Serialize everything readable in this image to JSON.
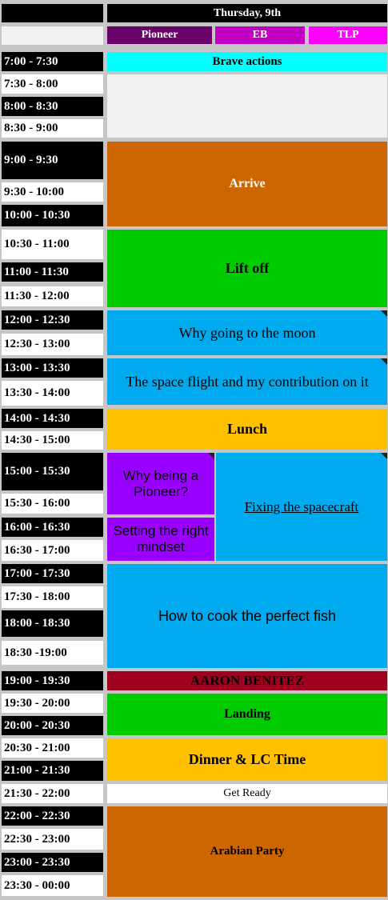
{
  "header": {
    "day": "Thursday, 9th",
    "tracks": [
      {
        "label": "Pioneer",
        "color": "#6a006a"
      },
      {
        "label": "EB",
        "color": "#c000c0"
      },
      {
        "label": "TLP",
        "color": "#ff00ff"
      }
    ]
  },
  "times": [
    "7:00 - 7:30",
    "7:30 - 8:00",
    "8:00 - 8:30",
    "8:30 - 9:00",
    "9:00 - 9:30",
    "9:30 - 10:00",
    "10:00 - 10:30",
    "10:30 - 11:00",
    "11:00 - 11:30",
    "11:30 - 12:00",
    "12:00 - 12:30",
    "12:30 - 13:00",
    "13:00 - 13:30",
    "13:30 - 14:00",
    "14:00 - 14:30",
    "14:30 - 15:00",
    "15:00 - 15:30",
    "15:30 - 16:00",
    "16:00 - 16:30",
    "16:30 - 17:00",
    "17:00 - 17:30",
    "17:30 - 18:00",
    "18:00 - 18:30",
    "18:30 -19:00",
    "19:00 - 19:30",
    "19:30 - 20:00",
    "20:00 - 20:30",
    "20:30 - 21:00",
    "21:00 - 21:30",
    "21:30 - 22:00",
    "22:00 - 22:30",
    "22:30 - 23:00",
    "23:00 - 23:30",
    "23:30 - 00:00"
  ],
  "events": {
    "brave_actions": "Brave actions",
    "empty": "",
    "arrive": "Arrive",
    "lift_off": "Lift off",
    "why_moon": "Why going to the moon",
    "space_flight": "The space flight and my contribution on it",
    "lunch": "Lunch",
    "why_pioneer": "Why being a Pioneer?",
    "fixing_spacecraft": "Fixing the spacecraft",
    "mindset": "Setting the right mindset",
    "cook_fish": "How to cook the perfect fish",
    "aaron": "AARON BENITEZ",
    "landing": "Landing",
    "dinner": "Dinner & LC Time",
    "get_ready": "Get Ready",
    "arabian_party": "Arabian Party"
  },
  "colors": {
    "cyan": "#00ffff",
    "orange": "#cc6600",
    "green": "#00cc00",
    "blue": "#00aaee",
    "yellow": "#ffc000",
    "purple": "#9900ff",
    "maroon": "#a00020"
  }
}
